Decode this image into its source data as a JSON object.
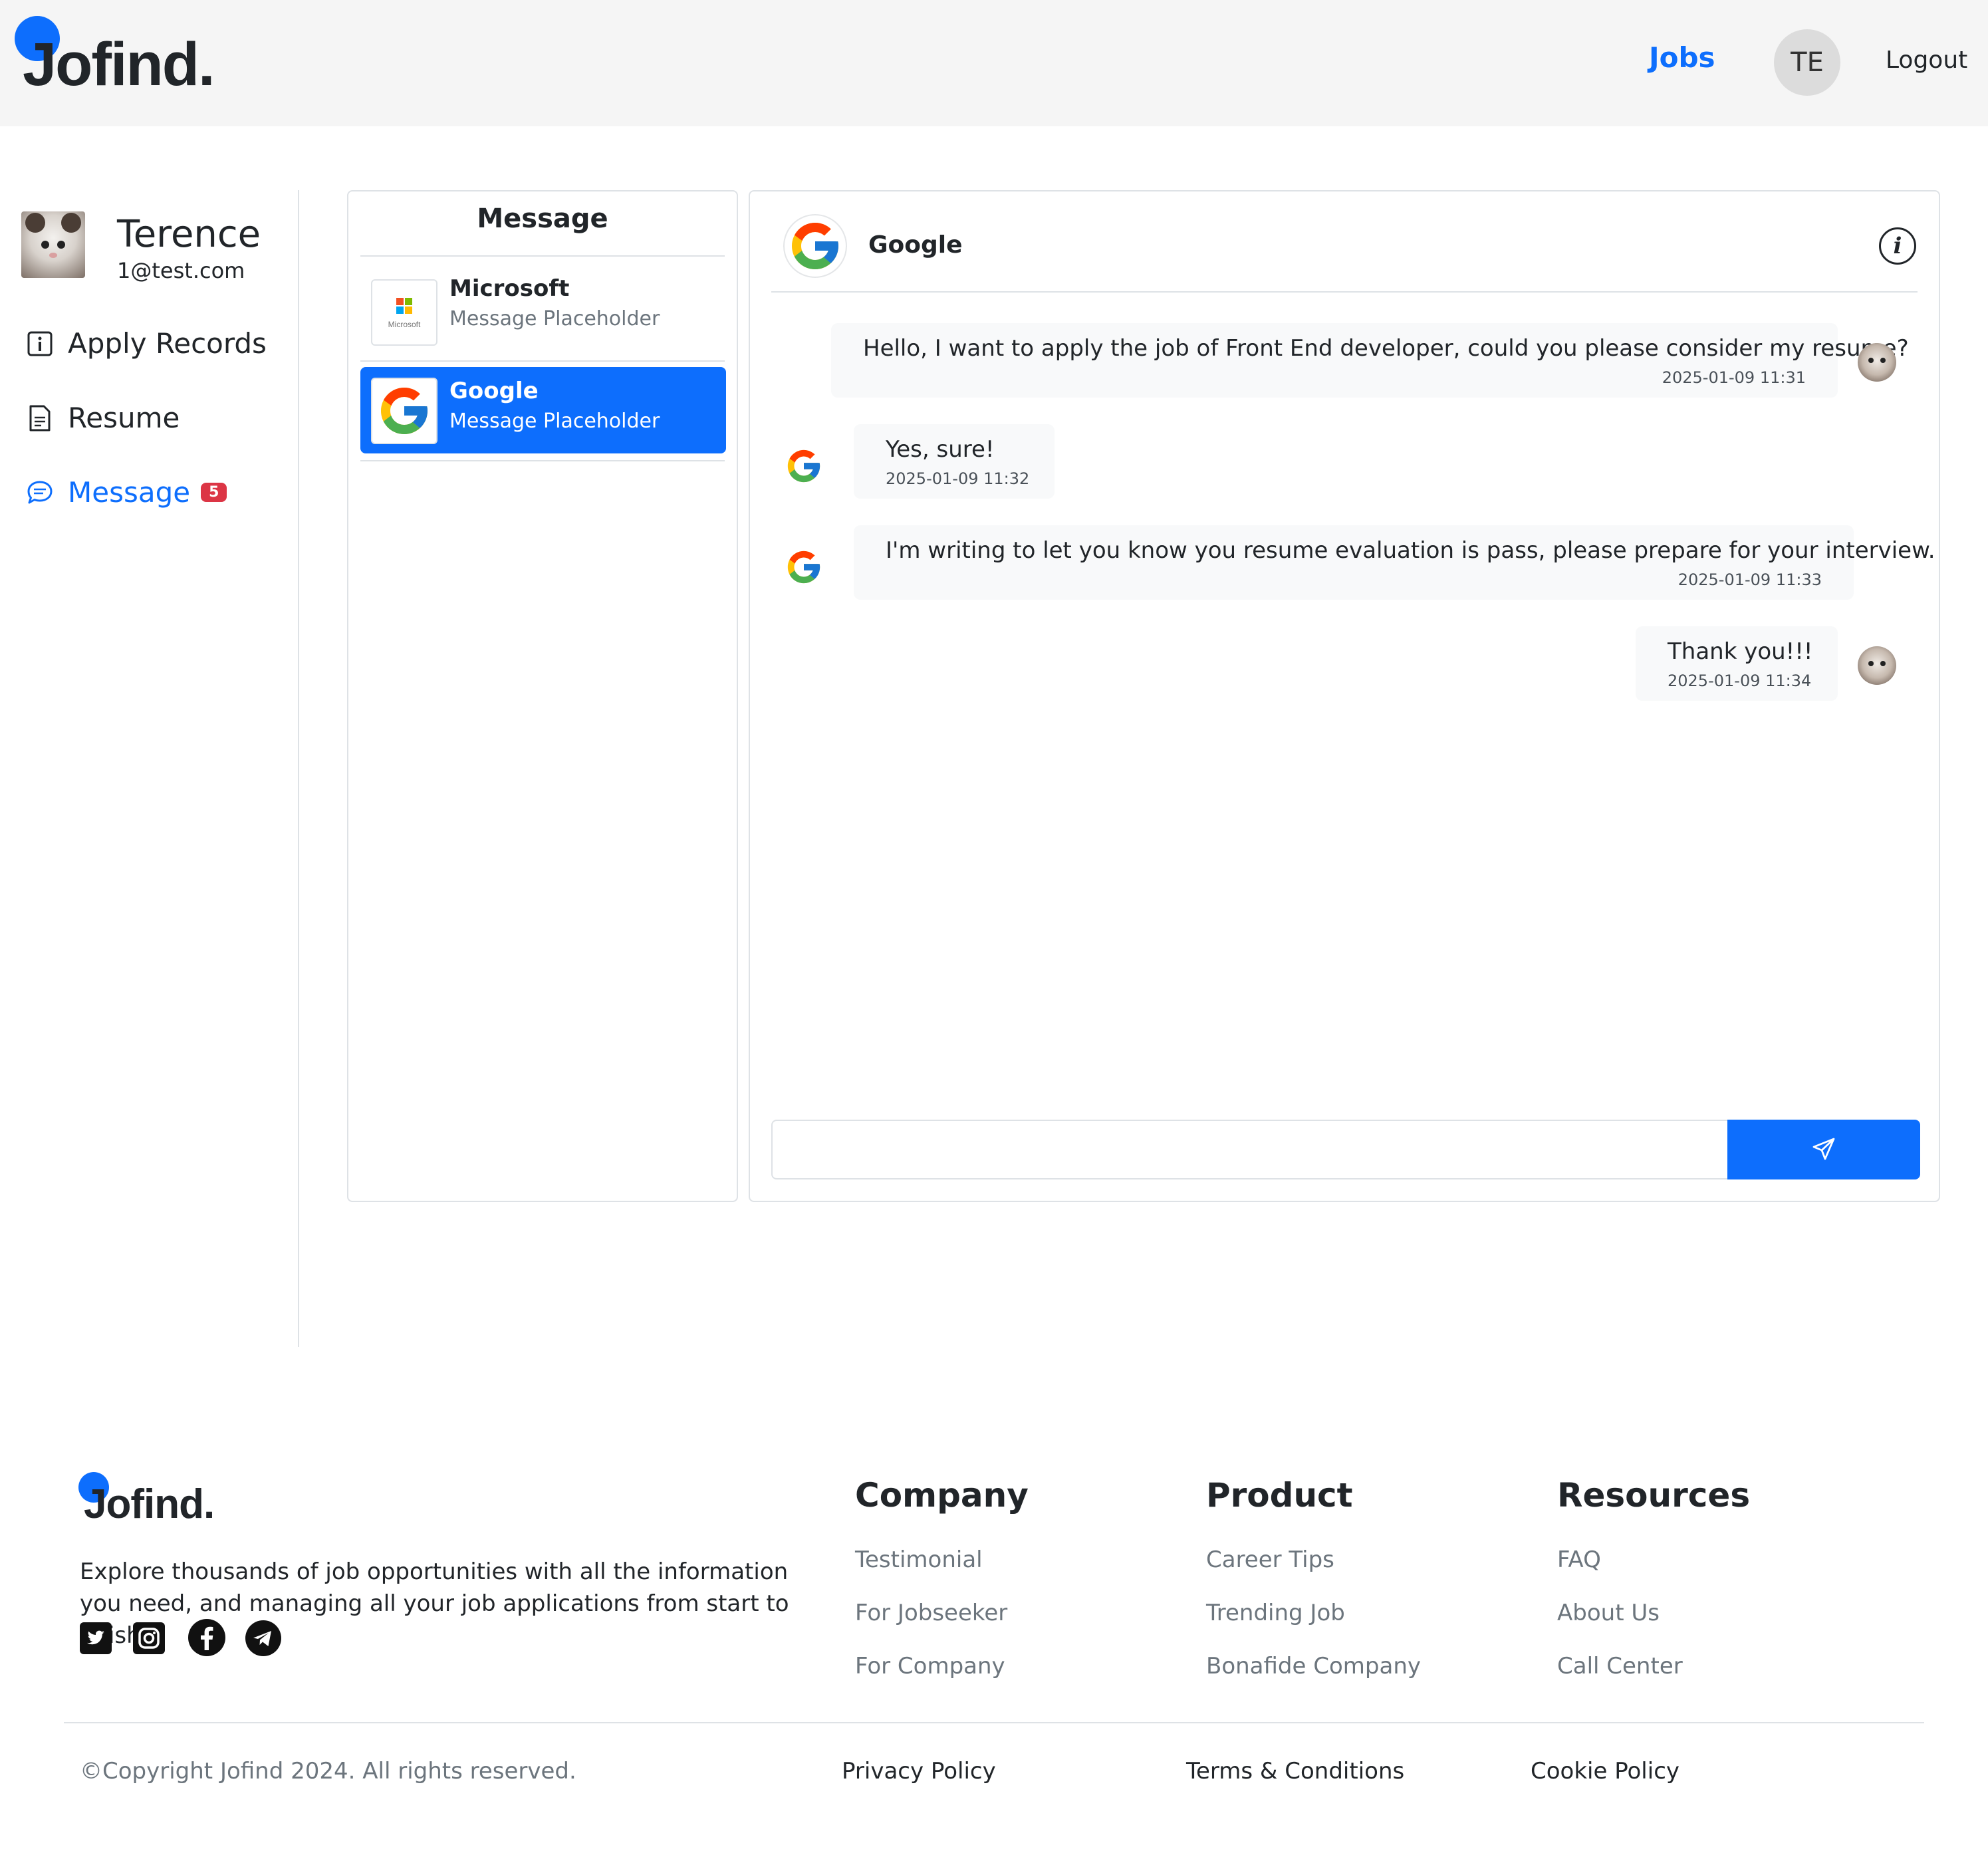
{
  "header": {
    "logo_text": "Jofind.",
    "nav_jobs": "Jobs",
    "avatar_initials": "TE",
    "logout": "Logout"
  },
  "colors": {
    "accent": "#0d6efd",
    "badge": "#dc3545",
    "header_bg": "#f5f5f5",
    "bubble_bg": "#f8f9fa"
  },
  "sidebar": {
    "user_name": "Terence",
    "user_email": "1@test.com",
    "items": [
      {
        "label": "Apply Records",
        "icon": "info-square-icon",
        "active": false
      },
      {
        "label": "Resume",
        "icon": "document-icon",
        "active": false
      },
      {
        "label": "Message",
        "icon": "chat-icon",
        "active": true,
        "badge": "5"
      }
    ]
  },
  "message_list": {
    "title": "Message",
    "conversations": [
      {
        "name": "Microsoft",
        "preview": "Message Placeholder",
        "logo": "microsoft-logo",
        "logo_caption": "Microsoft",
        "active": false
      },
      {
        "name": "Google",
        "preview": "Message Placeholder",
        "logo": "google-logo",
        "active": true
      }
    ]
  },
  "chat": {
    "company": "Google",
    "info_icon": "info-circle-icon",
    "messages": [
      {
        "sender": "user",
        "text": "Hello, I want to apply the job of Front End developer, could you please consider my resume?",
        "time": "2025-01-09 11:31"
      },
      {
        "sender": "company",
        "text": "Yes, sure!",
        "time": "2025-01-09 11:32"
      },
      {
        "sender": "company",
        "text": "I'm writing to let you know you resume evaluation is pass, please prepare for your interview.",
        "time": "2025-01-09 11:33"
      },
      {
        "sender": "user",
        "text": "Thank you!!!",
        "time": "2025-01-09 11:34"
      }
    ],
    "input_value": "",
    "send_icon": "send-icon"
  },
  "footer": {
    "logo_text": "Jofind.",
    "description": "Explore thousands of job opportunities with all the information you need, and managing all your job applications from start to finish.",
    "social": [
      "twitter-icon",
      "instagram-icon",
      "facebook-icon",
      "telegram-icon"
    ],
    "columns": [
      {
        "title": "Company",
        "links": [
          "Testimonial",
          "For Jobseeker",
          "For Company"
        ]
      },
      {
        "title": "Product",
        "links": [
          "Career Tips",
          "Trending Job",
          "Bonafide Company"
        ]
      },
      {
        "title": "Resources",
        "links": [
          "FAQ",
          "About Us",
          "Call Center"
        ]
      }
    ],
    "copyright": "©Copyright Jofind 2024. All rights reserved.",
    "bottom_links": [
      "Privacy Policy",
      "Terms & Conditions",
      "Cookie Policy"
    ]
  }
}
